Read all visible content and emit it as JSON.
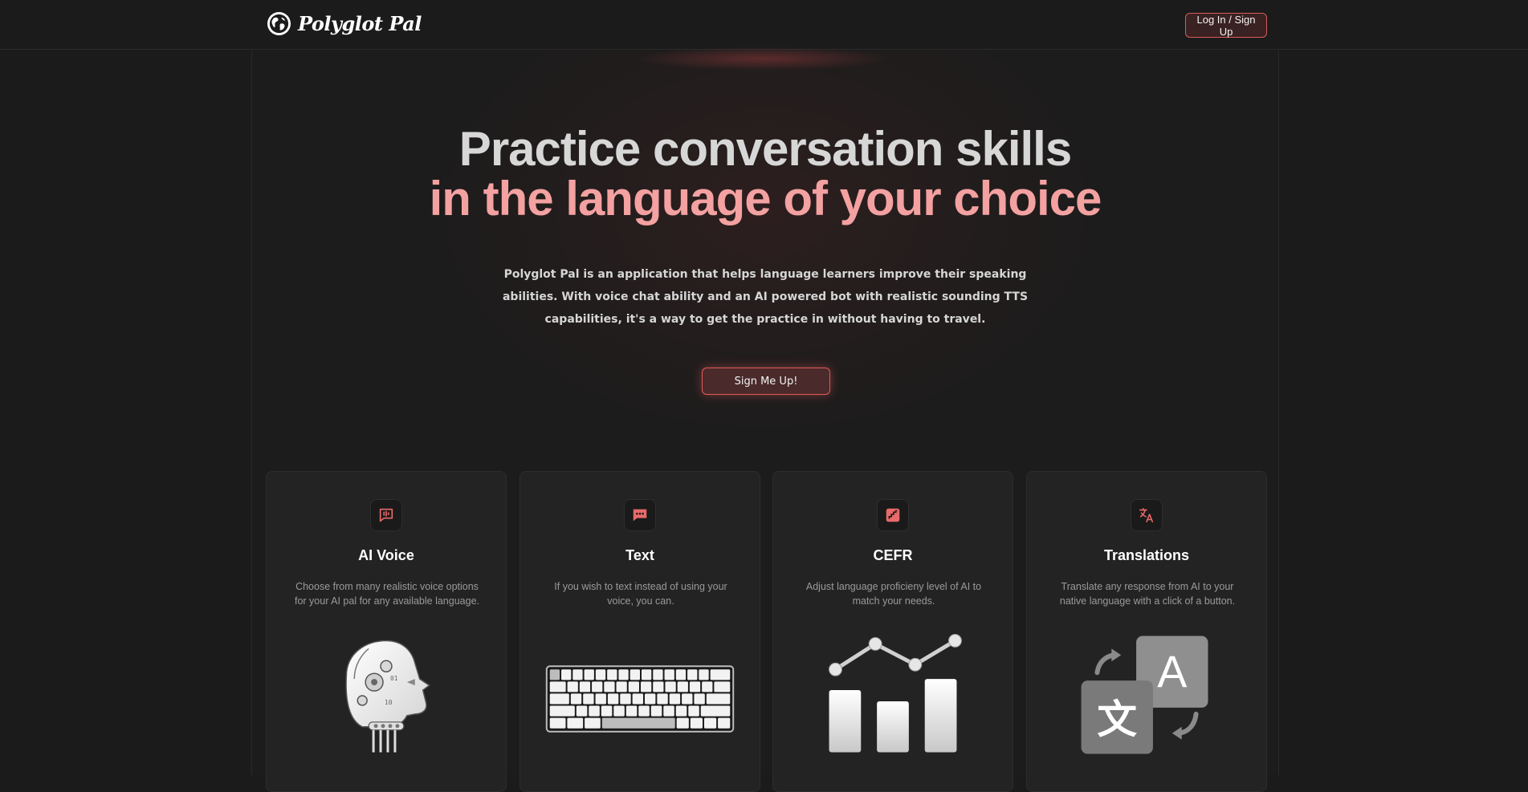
{
  "header": {
    "brand_name": "Polyglot Pal",
    "login_label": "Log In / Sign Up"
  },
  "hero": {
    "title_line1": "Practice conversation skills",
    "title_line2": "in the language of your choice",
    "description": "Polyglot Pal is an application that helps language learners improve their speaking abilities. With voice chat ability and an AI powered bot with realistic sounding TTS capabilities, it's a way to get the practice in without having to travel.",
    "cta_label": "Sign Me Up!"
  },
  "features": [
    {
      "title": "AI Voice",
      "description": "Choose from many realistic voice options for your AI pal for any available language.",
      "icon": "voice-message-icon",
      "illustration": "robot-head-illustration"
    },
    {
      "title": "Text",
      "description": "If you wish to text instead of using your voice, you can.",
      "icon": "chat-bubble-icon",
      "illustration": "keyboard-illustration"
    },
    {
      "title": "CEFR",
      "description": "Adjust language proficieny level of AI to match your needs.",
      "icon": "stairs-icon",
      "illustration": "bar-chart-illustration"
    },
    {
      "title": "Translations",
      "description": "Translate any response from AI to your native language with a click of a button.",
      "icon": "translate-icon",
      "illustration": "translation-illustration"
    }
  ],
  "colors": {
    "accent": "#e05a5a",
    "accent_light": "#f4a1a1",
    "background": "#1b1b1b",
    "card": "#232323"
  }
}
